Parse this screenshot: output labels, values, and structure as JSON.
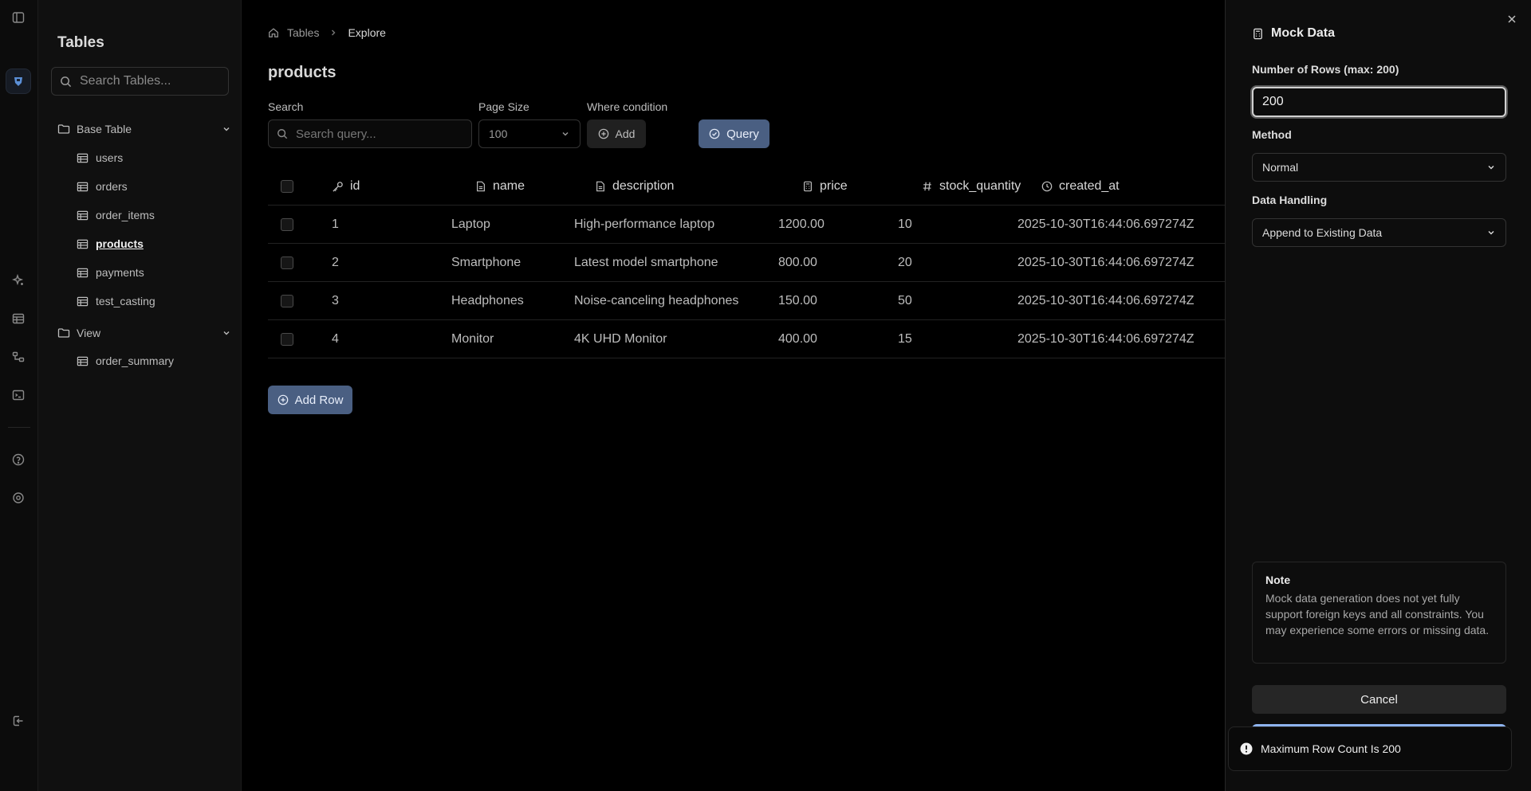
{
  "sidebar": {
    "title": "Tables",
    "search_placeholder": "Search Tables...",
    "groups": [
      {
        "label": "Base Table",
        "items": [
          "users",
          "orders",
          "order_items",
          "products",
          "payments",
          "test_casting"
        ]
      },
      {
        "label": "View",
        "items": [
          "order_summary"
        ]
      }
    ],
    "active_item": "products"
  },
  "breadcrumb": {
    "root": "Tables",
    "current": "Explore"
  },
  "page": {
    "title": "products"
  },
  "filters": {
    "search_label": "Search",
    "search_placeholder": "Search query...",
    "page_size_label": "Page Size",
    "page_size_value": "100",
    "where_label": "Where condition",
    "add_label": "Add",
    "query_label": "Query"
  },
  "table": {
    "columns": [
      {
        "label": "id",
        "icon": "key-icon"
      },
      {
        "label": "name",
        "icon": "file-text-icon"
      },
      {
        "label": "description",
        "icon": "file-text-icon"
      },
      {
        "label": "price",
        "icon": "calculator-icon"
      },
      {
        "label": "stock_quantity",
        "icon": "hash-icon"
      },
      {
        "label": "created_at",
        "icon": "clock-icon"
      }
    ],
    "rows": [
      [
        "1",
        "Laptop",
        "High-performance laptop",
        "1200.00",
        "10",
        "2025-10-30T16:44:06.697274Z"
      ],
      [
        "2",
        "Smartphone",
        "Latest model smartphone",
        "800.00",
        "20",
        "2025-10-30T16:44:06.697274Z"
      ],
      [
        "3",
        "Headphones",
        "Noise-canceling headphones",
        "150.00",
        "50",
        "2025-10-30T16:44:06.697274Z"
      ],
      [
        "4",
        "Monitor",
        "4K UHD Monitor",
        "400.00",
        "15",
        "2025-10-30T16:44:06.697274Z"
      ]
    ],
    "add_row_label": "Add Row"
  },
  "mock_panel": {
    "title": "Mock Data",
    "rows_label": "Number of Rows (max: 200)",
    "rows_value": "200",
    "method_label": "Method",
    "method_value": "Normal",
    "handling_label": "Data Handling",
    "handling_value": "Append to Existing Data",
    "note_title": "Note",
    "note_body": "Mock data generation does not yet fully support foreign keys and all constraints. You may experience some errors or missing data.",
    "cancel_label": "Cancel"
  },
  "toast": {
    "message": "Maximum Row Count Is 200"
  },
  "colors": {
    "accent": "#4a5f82",
    "confirm": "#8eb4ef",
    "background": "#000000"
  }
}
